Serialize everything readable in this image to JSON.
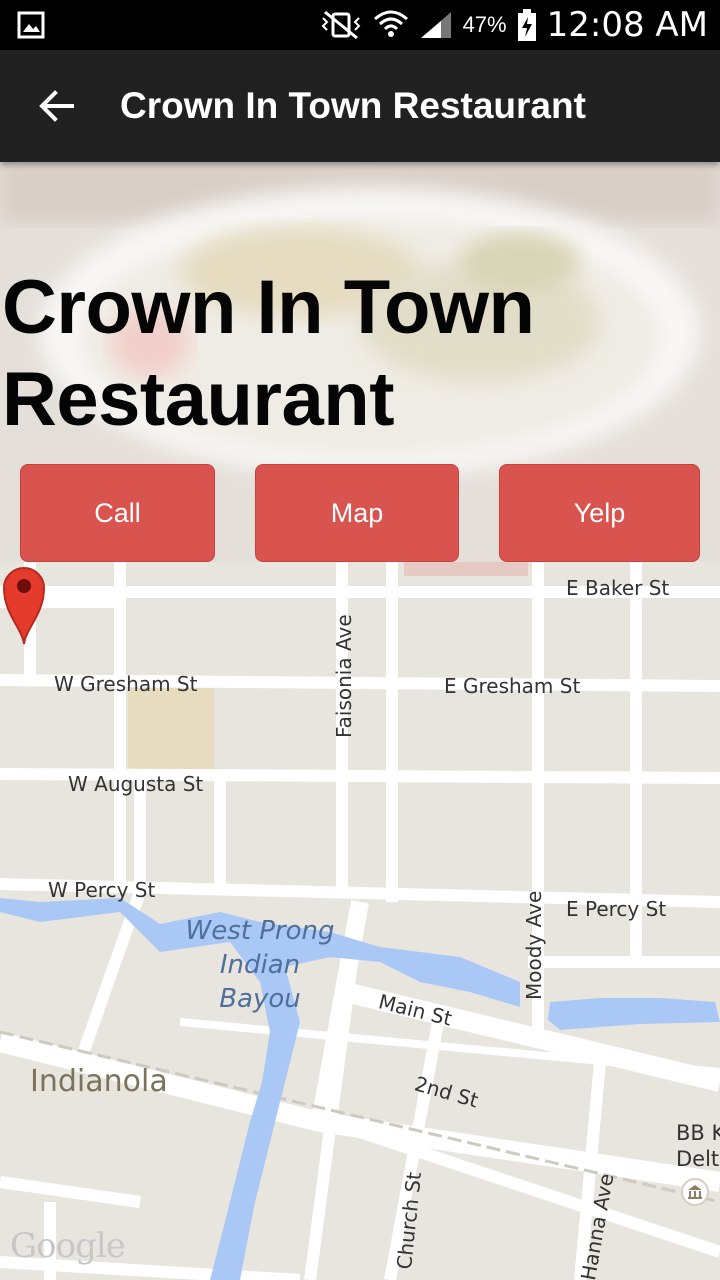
{
  "status_bar": {
    "battery": "47%",
    "time": "12:08 AM"
  },
  "app_bar": {
    "title": "Crown In Town Restaurant"
  },
  "hero": {
    "title_line1": "Crown In Town",
    "title_line2": "Restaurant"
  },
  "actions": {
    "call": "Call",
    "map": "Map",
    "yelp": "Yelp"
  },
  "map": {
    "streets": {
      "e_baker": "E Baker St",
      "w_gresham": "W Gresham St",
      "e_gresham": "E Gresham St",
      "faisonia": "Faisonia Ave",
      "w_augusta": "W Augusta St",
      "w_percy": "W Percy St",
      "e_percy": "E Percy St",
      "moody": "Moody Ave",
      "main": "Main St",
      "second": "2nd St",
      "church": "Church St",
      "hanna": "Hanna Ave"
    },
    "water_label_line1": "West Prong",
    "water_label_line2": "Indian Bayou",
    "city": "Indianola",
    "poi_line1": "BB K",
    "poi_line2": "Delta",
    "attribution": "Google"
  },
  "colors": {
    "app_bar": "#212121",
    "button": "#d9534f",
    "water": "#a9c8f5",
    "pin": "#e53b2c"
  }
}
